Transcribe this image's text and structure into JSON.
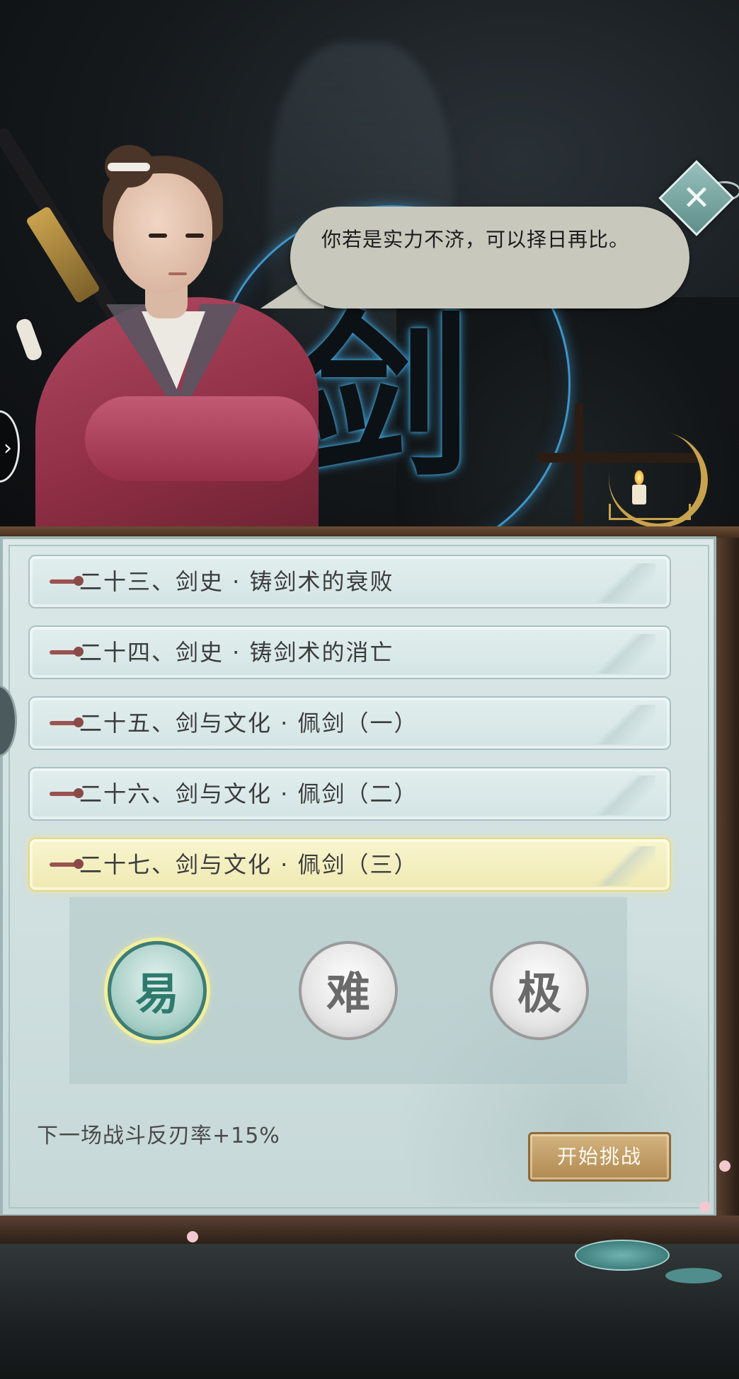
{
  "dialog": {
    "text": "你若是实力不济，可以择日再比。"
  },
  "emblem": {
    "character": "剑"
  },
  "close_button": {
    "glyph": "✕"
  },
  "chapters": [
    {
      "label": "二十三、剑史 · 铸剑术的衰败",
      "selected": false
    },
    {
      "label": "二十四、剑史 · 铸剑术的消亡",
      "selected": false
    },
    {
      "label": "二十五、剑与文化 · 佩剑（一）",
      "selected": false
    },
    {
      "label": "二十六、剑与文化 · 佩剑（二）",
      "selected": false
    },
    {
      "label": "二十七、剑与文化 · 佩剑（三）",
      "selected": true
    }
  ],
  "difficulty": {
    "selected": "易",
    "options": [
      {
        "label": "易"
      },
      {
        "label": "难"
      },
      {
        "label": "极"
      }
    ]
  },
  "effect_text": "下一场战斗反刃率+15%",
  "start_button_label": "开始挑战",
  "colors": {
    "accent_gold": "#c9a24d",
    "selected_chapter": "#efe9b2",
    "panel_bg": "#d5e4e4",
    "emblem_glow": "#46aae6"
  }
}
